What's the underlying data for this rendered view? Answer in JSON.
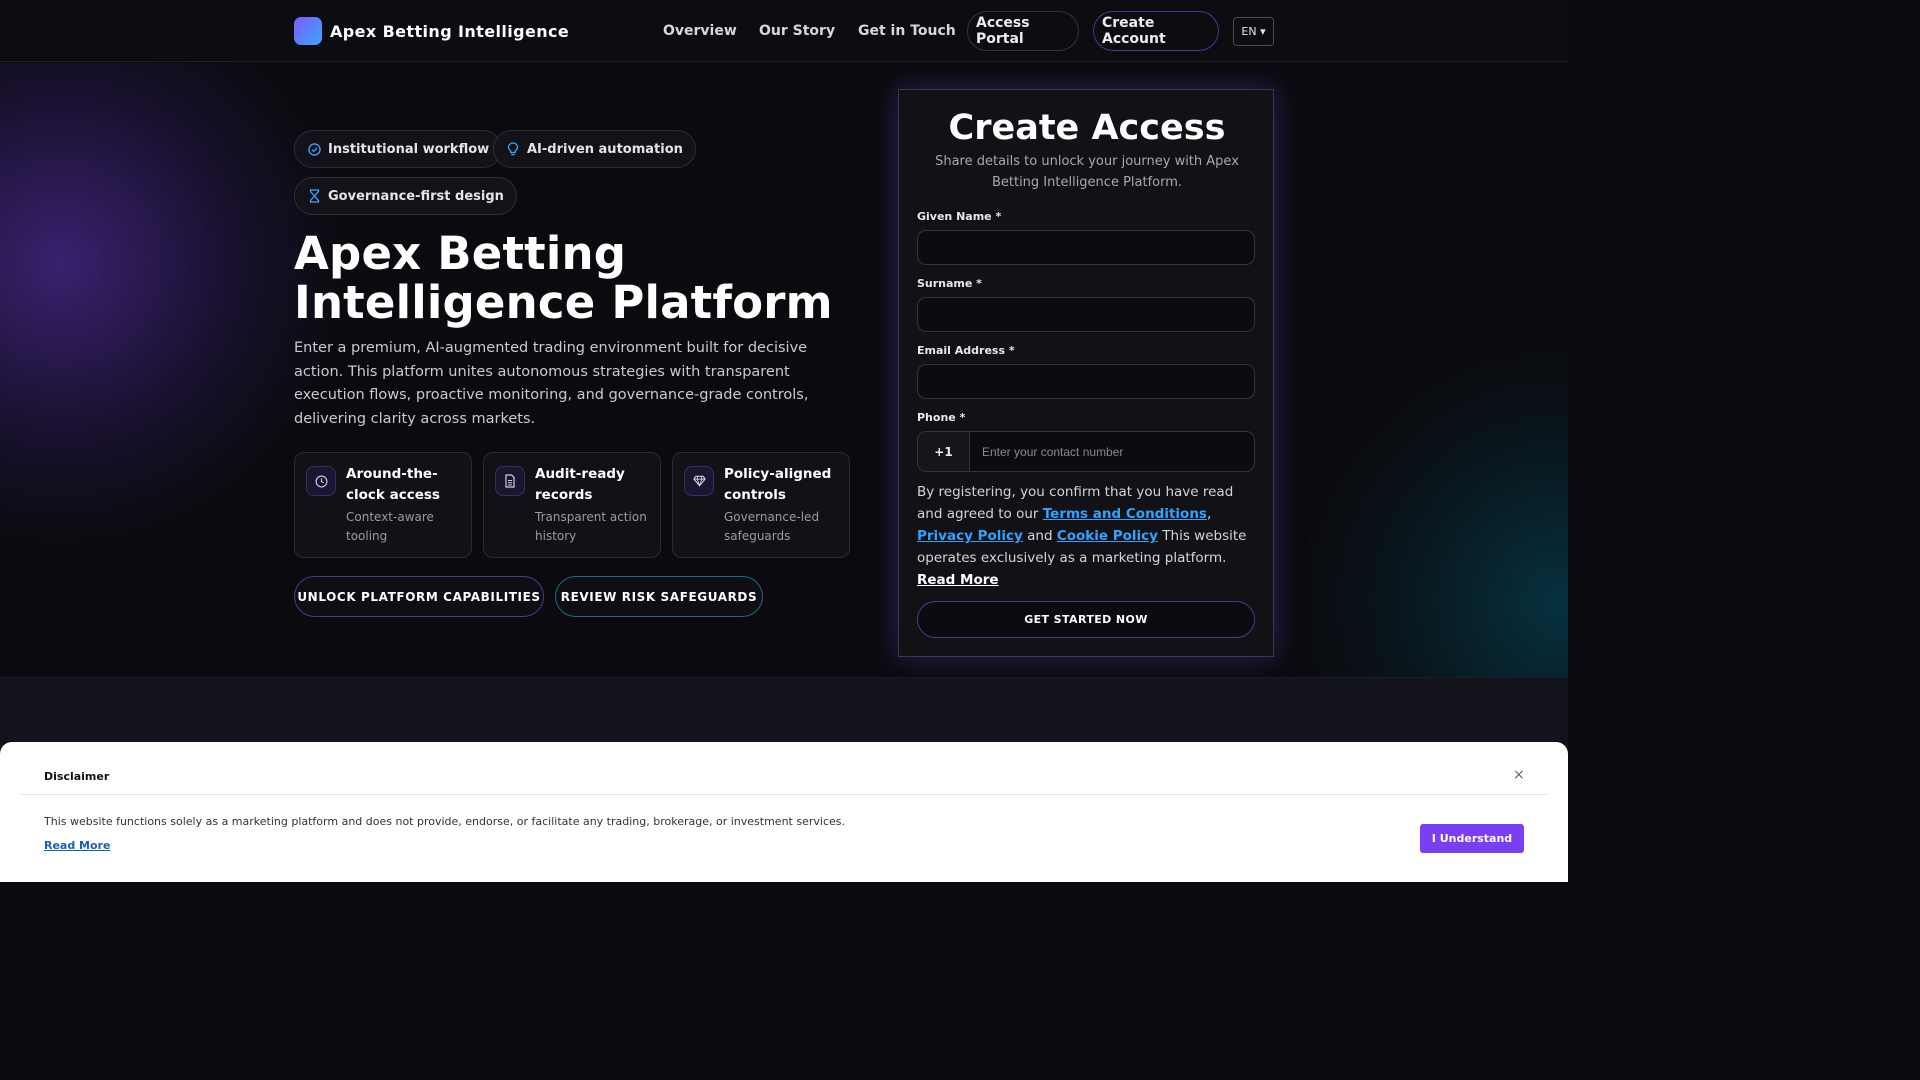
{
  "header": {
    "brand": "Apex Betting Intelligence",
    "nav": [
      "Overview",
      "Our Story",
      "Get in Touch"
    ],
    "access_portal": "Access Portal",
    "create_account": "Create Account",
    "language": "EN ▾"
  },
  "hero": {
    "badges": [
      {
        "label": "Institutional workflow",
        "icon": "check-circle-icon"
      },
      {
        "label": "AI-driven automation",
        "icon": "lightbulb-icon"
      },
      {
        "label": "Governance-first design",
        "icon": "hourglass-icon"
      }
    ],
    "title": "Apex Betting Intelligence Platform",
    "description": "Enter a premium, AI-augmented trading environment built for decisive action. This platform unites autonomous strategies with transparent execution flows, proactive monitoring, and governance-grade controls, delivering clarity across markets.",
    "features": [
      {
        "title": "Around-the-clock access",
        "subtitle": "Context-aware tooling",
        "icon": "clock-icon"
      },
      {
        "title": "Audit-ready records",
        "subtitle": "Transparent action history",
        "icon": "document-icon"
      },
      {
        "title": "Policy-aligned controls",
        "subtitle": "Governance-led safeguards",
        "icon": "gem-icon"
      }
    ],
    "cta_primary": "UNLOCK PLATFORM CAPABILITIES",
    "cta_secondary": "REVIEW RISK SAFEGUARDS"
  },
  "form": {
    "title": "Create Access",
    "subtitle": "Share details to unlock your journey with Apex Betting Intelligence Platform.",
    "given_name_label": "Given Name *",
    "surname_label": "Surname *",
    "email_label": "Email Address *",
    "phone_label": "Phone *",
    "phone_code": "+1",
    "phone_placeholder": "Enter your contact number",
    "legal_prefix": "By registering, you confirm that you have read and agreed to our",
    "terms": "Terms and Conditions",
    "privacy": "Privacy Policy",
    "and": "and",
    "cookie": "Cookie Policy",
    "legal_suffix": "This website operates exclusively as a marketing platform.",
    "read_more": "Read More",
    "submit": "GET STARTED NOW"
  },
  "disclaimer": {
    "title": "Disclaimer",
    "close": "×",
    "text": "This website functions solely as a marketing platform and does not provide, endorse, or facilitate any trading, brokerage, or investment services.",
    "read_more": "Read More",
    "button": "I Understand"
  },
  "colors": {
    "accent_purple": "#7b3ff2",
    "accent_blue": "#2fa4ff",
    "background": "#0b0b10"
  }
}
